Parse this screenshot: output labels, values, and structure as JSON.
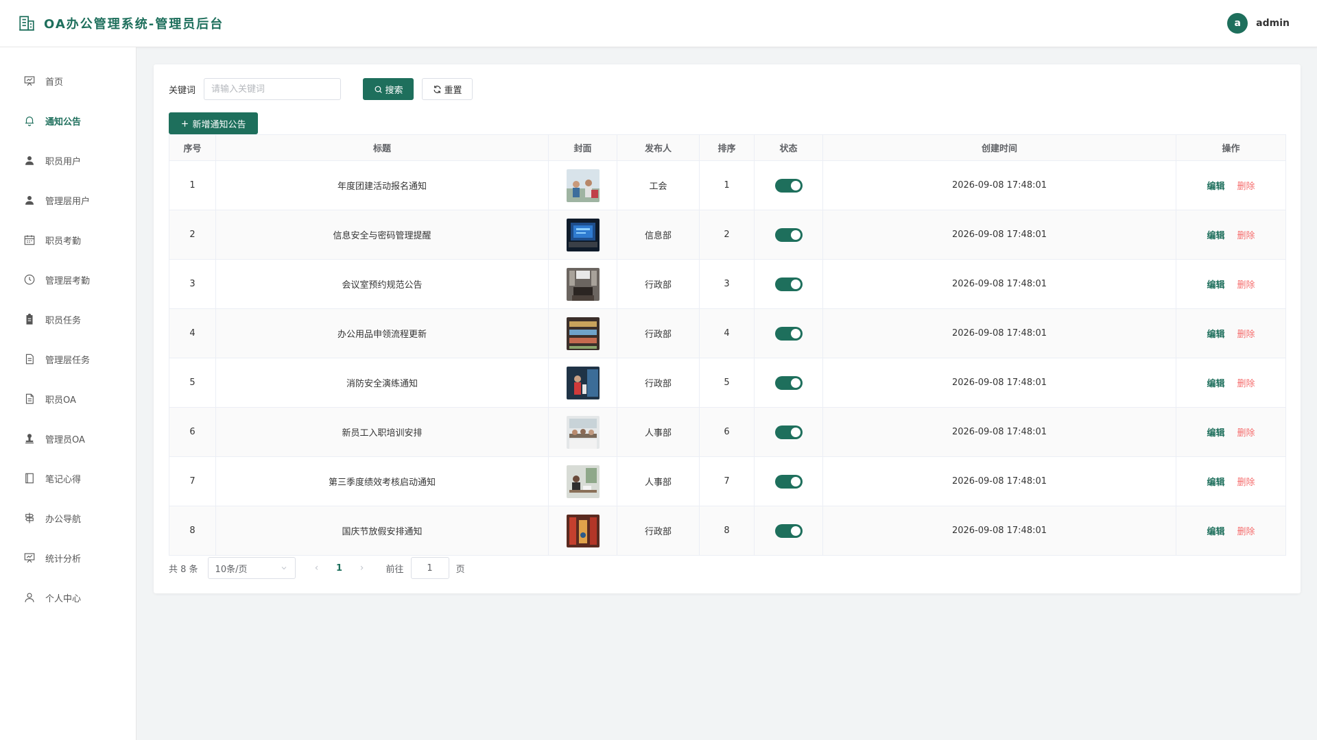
{
  "header": {
    "title": "OA办公管理系统-管理员后台",
    "avatar_letter": "a",
    "username": "admin",
    "accent": "#1e6f5c"
  },
  "sidebar": {
    "items": [
      {
        "label": "首页",
        "icon": "presentation-icon",
        "active": false
      },
      {
        "label": "通知公告",
        "icon": "bell-icon",
        "active": true
      },
      {
        "label": "职员用户",
        "icon": "user-icon",
        "active": false
      },
      {
        "label": "管理层用户",
        "icon": "user-icon",
        "active": false
      },
      {
        "label": "职员考勤",
        "icon": "calendar-icon",
        "active": false
      },
      {
        "label": "管理层考勤",
        "icon": "clock-icon",
        "active": false
      },
      {
        "label": "职员任务",
        "icon": "clipboard-icon",
        "active": false
      },
      {
        "label": "管理层任务",
        "icon": "document-icon",
        "active": false
      },
      {
        "label": "职员OA",
        "icon": "document-icon",
        "active": false
      },
      {
        "label": "管理员OA",
        "icon": "stamp-icon",
        "active": false
      },
      {
        "label": "笔记心得",
        "icon": "notebook-icon",
        "active": false
      },
      {
        "label": "办公导航",
        "icon": "signpost-icon",
        "active": false
      },
      {
        "label": "统计分析",
        "icon": "chart-board-icon",
        "active": false
      },
      {
        "label": "个人中心",
        "icon": "user-outline-icon",
        "active": false
      }
    ]
  },
  "search": {
    "label": "关键词",
    "placeholder": "请输入关键词",
    "search_label": "搜索",
    "reset_label": "重置",
    "add_label": "新增通知公告"
  },
  "table": {
    "columns": [
      "序号",
      "标题",
      "封面",
      "发布人",
      "排序",
      "状态",
      "创建时间",
      "操作"
    ],
    "edit_label": "编辑",
    "delete_label": "删除",
    "rows": [
      {
        "no": "1",
        "title": "年度团建活动报名通知",
        "cover": "team-event-photo",
        "publisher": "工会",
        "sort": "1",
        "status": true,
        "created": "2026-09-08 17:48:01"
      },
      {
        "no": "2",
        "title": "信息安全与密码管理提醒",
        "cover": "laptop-screen-photo",
        "publisher": "信息部",
        "sort": "2",
        "status": true,
        "created": "2026-09-08 17:48:01"
      },
      {
        "no": "3",
        "title": "会议室预约规范公告",
        "cover": "meeting-room-photo",
        "publisher": "行政部",
        "sort": "3",
        "status": true,
        "created": "2026-09-08 17:48:01"
      },
      {
        "no": "4",
        "title": "办公用品申领流程更新",
        "cover": "office-supplies-photo",
        "publisher": "行政部",
        "sort": "4",
        "status": true,
        "created": "2026-09-08 17:48:01"
      },
      {
        "no": "5",
        "title": "消防安全演练通知",
        "cover": "fire-drill-photo",
        "publisher": "行政部",
        "sort": "5",
        "status": true,
        "created": "2026-09-08 17:48:01"
      },
      {
        "no": "6",
        "title": "新员工入职培训安排",
        "cover": "training-photo",
        "publisher": "人事部",
        "sort": "6",
        "status": true,
        "created": "2026-09-08 17:48:01"
      },
      {
        "no": "7",
        "title": "第三季度绩效考核启动通知",
        "cover": "office-work-photo",
        "publisher": "人事部",
        "sort": "7",
        "status": true,
        "created": "2026-09-08 17:48:01"
      },
      {
        "no": "8",
        "title": "国庆节放假安排通知",
        "cover": "holiday-photo",
        "publisher": "行政部",
        "sort": "8",
        "status": true,
        "created": "2026-09-08 17:48:01"
      }
    ]
  },
  "pagination": {
    "total_text": "共 8 条",
    "page_size": "10条/页",
    "current_page": "1",
    "goto_label": "前往",
    "goto_value": "1",
    "page_unit": "页"
  }
}
